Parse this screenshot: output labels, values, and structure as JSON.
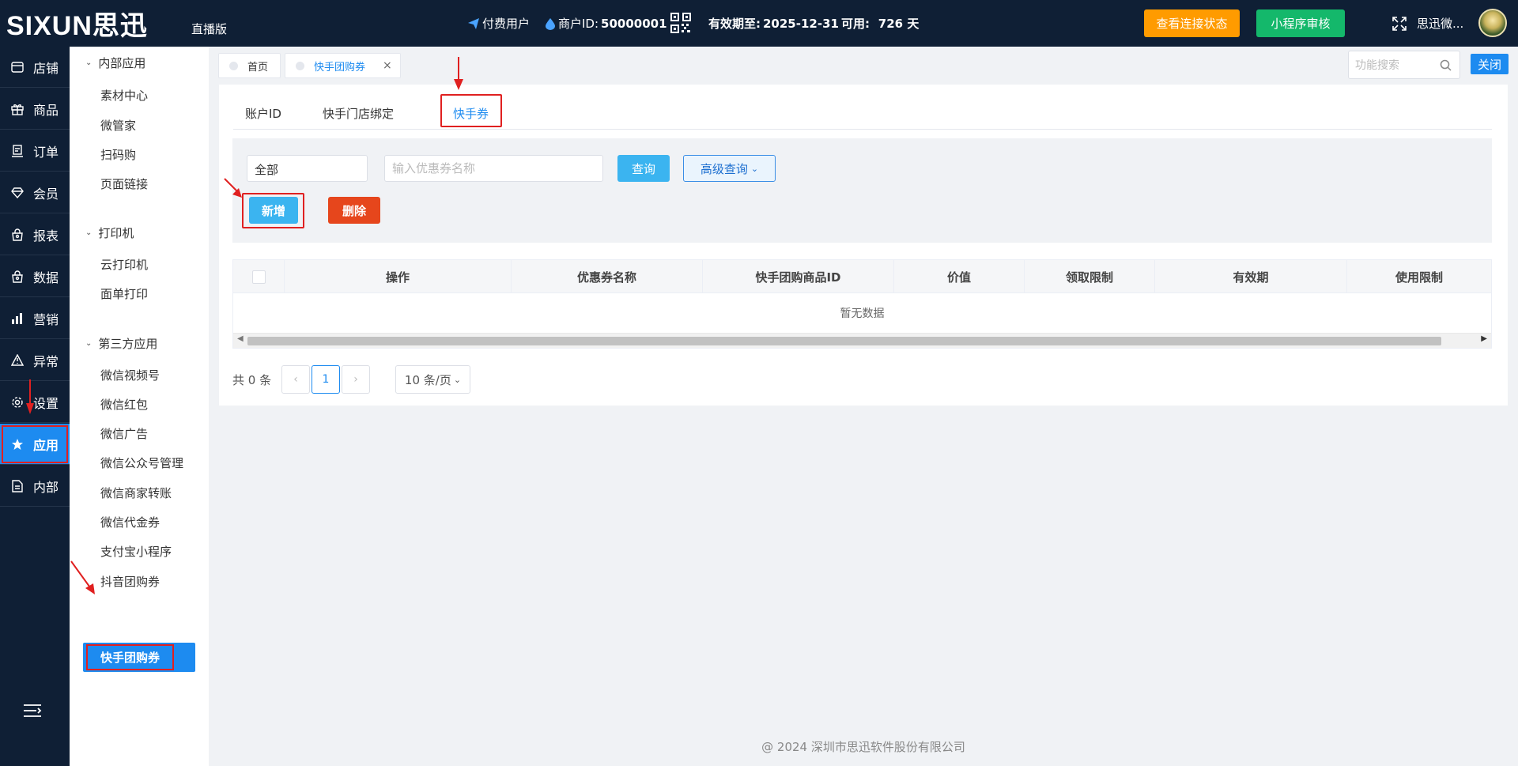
{
  "header": {
    "logo_text": "SIXUN思迅",
    "edition": "直播版",
    "user_type": "付费用户",
    "merchant_label": "商户ID:",
    "merchant_id": "50000001",
    "expiry_label": "有效期至:",
    "expiry_date": "2025-12-31",
    "available_label": "可用:",
    "available_days": "726 天",
    "connection_button": "查看连接状态",
    "miniprogram_button": "小程序审核",
    "user_name": "思迅微..."
  },
  "left_nav": {
    "items": [
      {
        "label": "店铺",
        "icon": "store-icon"
      },
      {
        "label": "商品",
        "icon": "gift-icon"
      },
      {
        "label": "订单",
        "icon": "order-icon"
      },
      {
        "label": "会员",
        "icon": "diamond-icon"
      },
      {
        "label": "报表",
        "icon": "basket-icon"
      },
      {
        "label": "数据",
        "icon": "data-icon"
      },
      {
        "label": "营销",
        "icon": "bar-chart-icon"
      },
      {
        "label": "异常",
        "icon": "warning-icon"
      },
      {
        "label": "设置",
        "icon": "gear-icon"
      },
      {
        "label": "应用",
        "icon": "star-icon"
      },
      {
        "label": "内部",
        "icon": "document-icon"
      }
    ],
    "active": "应用"
  },
  "submenu": {
    "groups": [
      {
        "title": "内部应用",
        "items": [
          "素材中心",
          "微管家",
          "扫码购",
          "页面链接"
        ]
      },
      {
        "title": "打印机",
        "items": [
          "云打印机",
          "面单打印"
        ]
      },
      {
        "title": "第三方应用",
        "items": [
          "微信视频号",
          "微信红包",
          "微信广告",
          "微信公众号管理",
          "微信商家转账",
          "微信代金券",
          "支付宝小程序",
          "抖音团购券"
        ]
      }
    ],
    "active_item": "快手团购券"
  },
  "page_tabs": [
    {
      "label": "首页"
    },
    {
      "label": "快手团购券",
      "close": "×"
    }
  ],
  "search": {
    "placeholder": "功能搜索"
  },
  "close_button": "关闭",
  "inner_tabs": [
    "账户ID",
    "快手门店绑定",
    "快手券"
  ],
  "inner_tab_active": "快手券",
  "filter": {
    "select_value": "全部",
    "name_placeholder": "输入优惠券名称",
    "query_button": "查询",
    "advanced_button": "高级查询",
    "add_button": "新增",
    "delete_button": "删除"
  },
  "table": {
    "columns": [
      "操作",
      "优惠券名称",
      "快手团购商品ID",
      "价值",
      "领取限制",
      "有效期",
      "使用限制"
    ],
    "empty_text": "暂无数据"
  },
  "pagination": {
    "total": "共 0 条",
    "current_page": "1",
    "page_size": "10 条/页"
  },
  "footer": "@ 2024 深圳市思迅软件股份有限公司"
}
